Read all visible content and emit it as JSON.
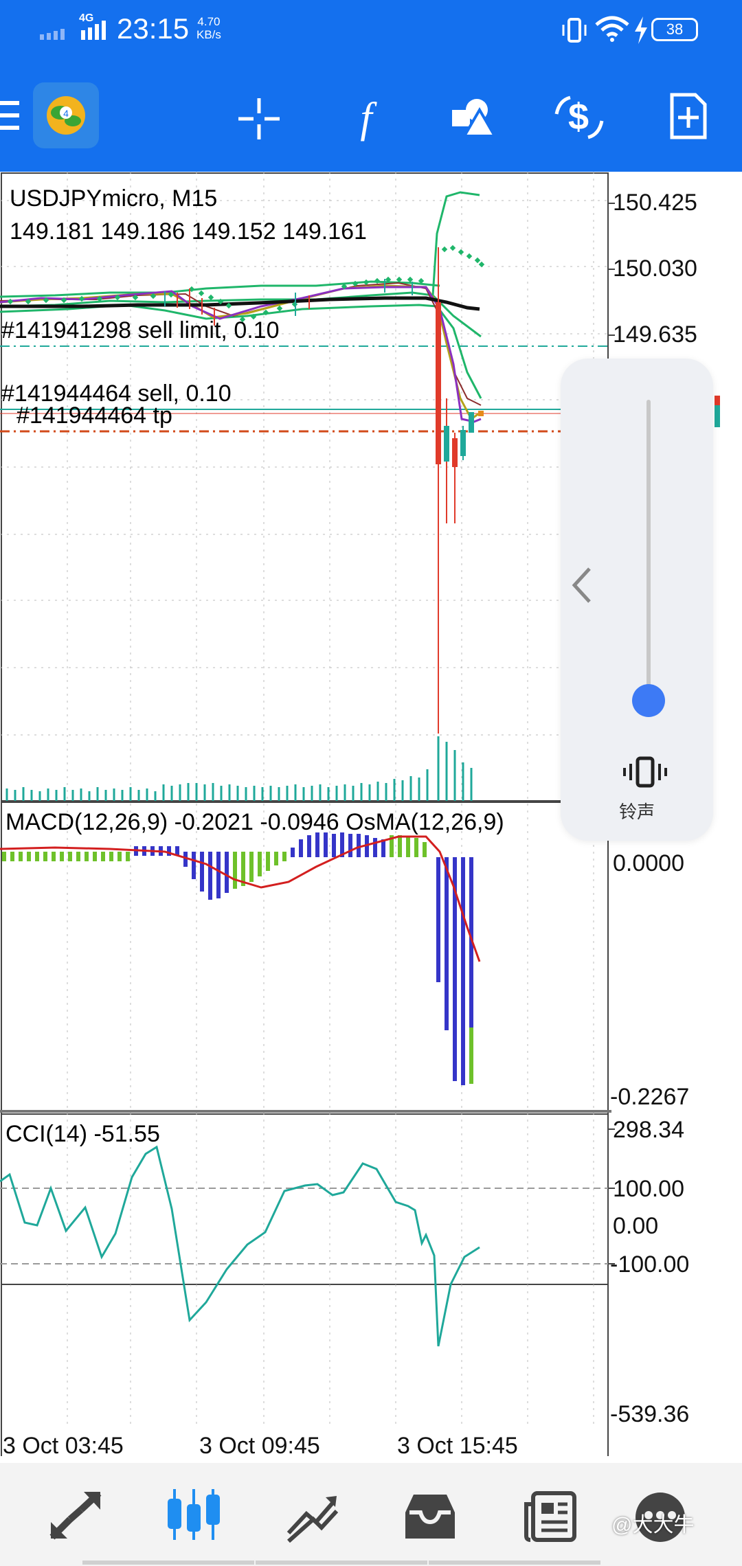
{
  "status_bar": {
    "network": "4G",
    "time": "23:15",
    "speed_value": "4.70",
    "speed_unit": "KB/s",
    "battery": "38"
  },
  "toolbar": {
    "icons": [
      "menu-icon",
      "mt4-app-icon",
      "crosshair-icon",
      "indicator-f-icon",
      "objects-icon",
      "trade-dollar-icon",
      "new-order-icon"
    ]
  },
  "chart": {
    "symbol_tf": "USDJPYmicro, M15",
    "ohlc": "149.181 149.186 149.152 149.161",
    "order_sell_limit": "#141941298 sell limit, 0.10",
    "order_sell": "#141944464 sell, 0.10",
    "order_tp": "#141944464 tp",
    "price_labels": [
      "150.425",
      "150.030",
      "149.635"
    ],
    "colors": {
      "bull": "#1fa89a",
      "bear": "#e03a2a",
      "ma_black": "#111111",
      "ma_green": "#1fb66a",
      "cyan": "#1fa89a",
      "macd_bar": "#3535c8",
      "osma_bar": "#6ec12a",
      "signal": "#d31f1f"
    }
  },
  "macd": {
    "label": "MACD(12,26,9) -0.2021 -0.0946 OsMA(12,26,9)",
    "axis_top": "0.0000",
    "axis_bottom": "-0.2267"
  },
  "cci": {
    "label": "CCI(14) -51.55",
    "axis": [
      "298.34",
      "100.00",
      "0.00",
      "-100.00",
      "-539.36"
    ]
  },
  "time_axis": [
    "3 Oct 03:45",
    "3 Oct 09:45",
    "3 Oct 15:45"
  ],
  "volume_popup": {
    "label": "铃声",
    "level": 0.0
  },
  "bottom_nav": {
    "items": [
      "quotes-icon",
      "chart-icon",
      "trade-icon",
      "history-icon",
      "news-icon",
      "messages-icon"
    ],
    "active": "chart-icon"
  },
  "watermark": "@大大牛"
}
